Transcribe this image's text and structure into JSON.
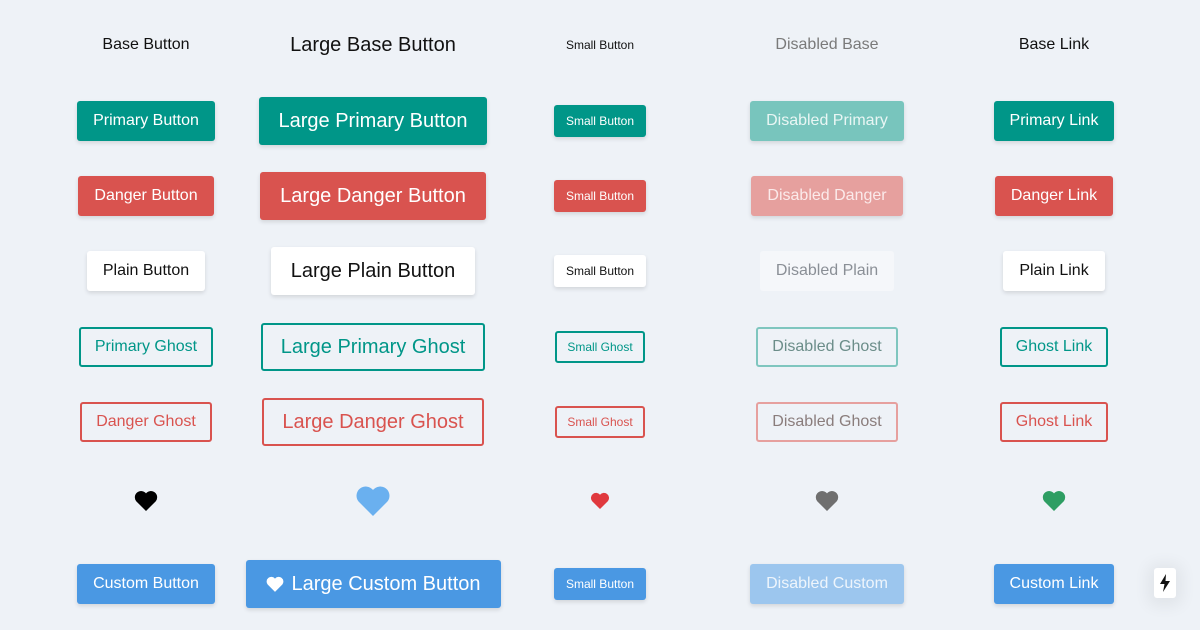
{
  "colors": {
    "primary": "#009688",
    "danger": "#d9534f",
    "custom": "#4a98e3",
    "background": "#eef2f7"
  },
  "rows": {
    "base": {
      "normal": "Base Button",
      "large": "Large Base Button",
      "small": "Small Button",
      "disabled": "Disabled Base",
      "link": "Base Link"
    },
    "primary": {
      "normal": "Primary Button",
      "large": "Large Primary Button",
      "small": "Small Button",
      "disabled": "Disabled Primary",
      "link": "Primary Link"
    },
    "danger": {
      "normal": "Danger Button",
      "large": "Large Danger Button",
      "small": "Small Button",
      "disabled": "Disabled Danger",
      "link": "Danger Link"
    },
    "plain": {
      "normal": "Plain Button",
      "large": "Large Plain Button",
      "small": "Small Button",
      "disabled": "Disabled Plain",
      "link": "Plain Link"
    },
    "primary_ghost": {
      "normal": "Primary Ghost",
      "large": "Large Primary Ghost",
      "small": "Small Ghost",
      "disabled": "Disabled Ghost",
      "link": "Ghost Link"
    },
    "danger_ghost": {
      "normal": "Danger Ghost",
      "large": "Large Danger Ghost",
      "small": "Small Ghost",
      "disabled": "Disabled Ghost",
      "link": "Ghost Link"
    },
    "icons": {
      "normal": "heart-icon",
      "large": "heart-icon",
      "small": "heart-icon",
      "disabled": "heart-icon",
      "link": "heart-icon",
      "colors": [
        "#000000",
        "#6ab0ef",
        "#e0393e",
        "#6f6f6f",
        "#2e9e63"
      ]
    },
    "custom": {
      "normal": "Custom Button",
      "large": "Large Custom Button",
      "large_icon": "heart-icon",
      "small": "Small Button",
      "disabled": "Disabled Custom",
      "link": "Custom Link"
    }
  },
  "side_button_icon": "lightning-bolt-icon"
}
